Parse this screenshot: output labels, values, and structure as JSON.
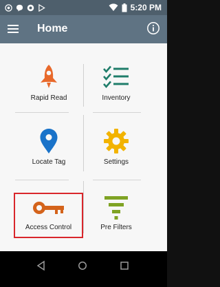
{
  "status_bar": {
    "time": "5:20 PM",
    "left_icons": [
      "camera-target-icon",
      "chat-icon",
      "notification-dot-icon",
      "play-store-icon"
    ],
    "right_icons": [
      "wifi-icon",
      "battery-icon"
    ]
  },
  "app_bar": {
    "title": "Home",
    "menu_icon": "hamburger-menu-icon",
    "info_icon": "info-icon"
  },
  "tiles": [
    {
      "label": "Rapid Read",
      "icon": "rocket-icon",
      "color": "#e8692b"
    },
    {
      "label": "Inventory",
      "icon": "checklist-icon",
      "color": "#1f7d6a"
    },
    {
      "label": "Locate Tag",
      "icon": "location-pin-icon",
      "color": "#1a73c9"
    },
    {
      "label": "Settings",
      "icon": "gear-icon",
      "color": "#f2b300"
    },
    {
      "label": "Access Control",
      "icon": "key-icon",
      "color": "#d4631b",
      "selected": true
    },
    {
      "label": "Pre Filters",
      "icon": "filter-funnel-icon",
      "color": "#7fa324"
    }
  ],
  "nav_bar": {
    "back_icon": "back-triangle-icon",
    "home_icon": "home-circle-icon",
    "recents_icon": "recents-square-icon"
  },
  "colors": {
    "status_bar": "#4e5f6c",
    "app_bar": "#5f7383",
    "highlight": "#d9262b"
  }
}
